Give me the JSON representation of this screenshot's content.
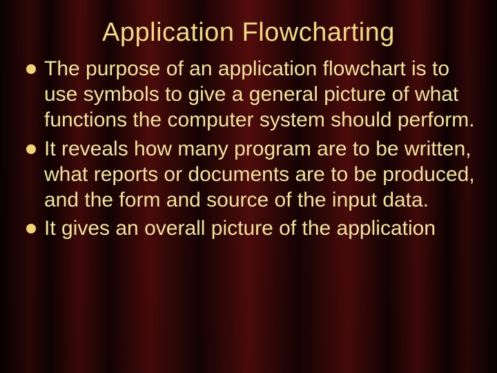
{
  "slide": {
    "title": "Application Flowcharting",
    "bullets": [
      "The purpose of an application flowchart is to use symbols to give a general picture of what functions the computer system should perform.",
      "It reveals how many program are to be written, what reports or documents are to be produced, and the form and source of the input data.",
      "It gives an overall picture of the application"
    ]
  }
}
